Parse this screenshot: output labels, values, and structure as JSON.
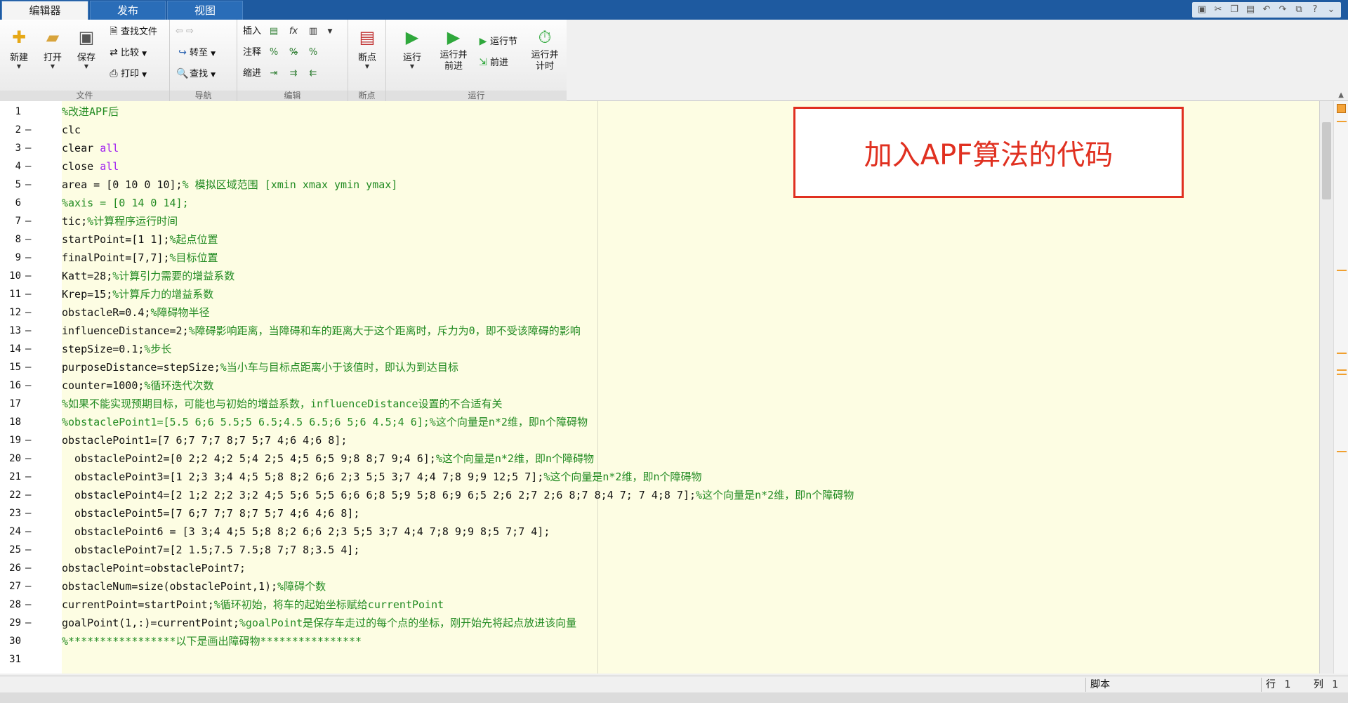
{
  "tabs": [
    {
      "label": "编辑器",
      "active": true
    },
    {
      "label": "发布",
      "active": false
    },
    {
      "label": "视图",
      "active": false
    }
  ],
  "quick_icons": [
    "save-icon",
    "cut-icon",
    "copy-icon",
    "paste-icon",
    "undo-icon",
    "redo-icon",
    "switch-window-icon",
    "help-icon",
    "collapse-icon"
  ],
  "ribbon": {
    "file": {
      "group": "文件",
      "new": "新建",
      "open": "打开",
      "save": "保存",
      "find_files": "查找文件",
      "compare": "比较",
      "print": "打印"
    },
    "nav": {
      "group": "导航",
      "goto": "转至",
      "find": "查找"
    },
    "edit": {
      "group": "编辑",
      "insert": "插入",
      "comment": "注释",
      "indent": "缩进"
    },
    "breakpoint": {
      "group": "断点",
      "breakpoints": "断点"
    },
    "run": {
      "group": "运行",
      "run": "运行",
      "run_advance_1": "运行并",
      "run_advance_2": "前进",
      "run_section": "运行节",
      "advance": "前进",
      "run_time_1": "运行并",
      "run_time_2": "计时"
    }
  },
  "annotation": "加入APF算法的代码",
  "status": {
    "mode": "脚本",
    "row_label": "行",
    "row_value": "1",
    "col_label": "列",
    "col_value": "1"
  },
  "code_lines": [
    {
      "n": "1",
      "dash": "",
      "parts": [
        [
          "cm",
          "%改进APF后"
        ]
      ]
    },
    {
      "n": "2",
      "dash": "—",
      "parts": [
        [
          "",
          "clc"
        ]
      ]
    },
    {
      "n": "3",
      "dash": "—",
      "parts": [
        [
          "",
          "clear "
        ],
        [
          "kw",
          "all"
        ]
      ]
    },
    {
      "n": "4",
      "dash": "—",
      "parts": [
        [
          "",
          "close "
        ],
        [
          "kw",
          "all"
        ]
      ]
    },
    {
      "n": "5",
      "dash": "—",
      "parts": [
        [
          "",
          "area = [0 10 0 10];"
        ],
        [
          "cm",
          "% 模拟区域范围 [xmin xmax ymin ymax]"
        ]
      ]
    },
    {
      "n": "6",
      "dash": "",
      "parts": [
        [
          "cm",
          "%axis = [0 14 0 14];"
        ]
      ]
    },
    {
      "n": "7",
      "dash": "—",
      "parts": [
        [
          "",
          "tic;"
        ],
        [
          "cm",
          "%计算程序运行时间"
        ]
      ]
    },
    {
      "n": "8",
      "dash": "—",
      "parts": [
        [
          "",
          "startPoint=[1 1];"
        ],
        [
          "cm",
          "%起点位置"
        ]
      ]
    },
    {
      "n": "9",
      "dash": "—",
      "parts": [
        [
          "",
          "finalPoint=[7,7];"
        ],
        [
          "cm",
          "%目标位置"
        ]
      ]
    },
    {
      "n": "10",
      "dash": "—",
      "parts": [
        [
          "",
          "Katt=28;"
        ],
        [
          "cm",
          "%计算引力需要的增益系数"
        ]
      ]
    },
    {
      "n": "11",
      "dash": "—",
      "parts": [
        [
          "",
          "Krep=15;"
        ],
        [
          "cm",
          "%计算斥力的增益系数"
        ]
      ]
    },
    {
      "n": "12",
      "dash": "—",
      "parts": [
        [
          "",
          "obstacleR=0.4;"
        ],
        [
          "cm",
          "%障碍物半径"
        ]
      ]
    },
    {
      "n": "13",
      "dash": "—",
      "parts": [
        [
          "",
          "influenceDistance=2;"
        ],
        [
          "cm",
          "%障碍影响距离，当障碍和车的距离大于这个距离时，斥力为0，即不受该障碍的影响"
        ]
      ]
    },
    {
      "n": "14",
      "dash": "—",
      "parts": [
        [
          "",
          "stepSize=0.1;"
        ],
        [
          "cm",
          "%步长"
        ]
      ]
    },
    {
      "n": "15",
      "dash": "—",
      "parts": [
        [
          "",
          "purposeDistance=stepSize;"
        ],
        [
          "cm",
          "%当小车与目标点距离小于该值时，即认为到达目标"
        ]
      ]
    },
    {
      "n": "16",
      "dash": "—",
      "parts": [
        [
          "",
          "counter=1000;"
        ],
        [
          "cm",
          "%循环迭代次数"
        ]
      ]
    },
    {
      "n": "17",
      "dash": "",
      "parts": [
        [
          "cm",
          "%如果不能实现预期目标，可能也与初始的增益系数，influenceDistance设置的不合适有关"
        ]
      ]
    },
    {
      "n": "18",
      "dash": "",
      "parts": [
        [
          "cm",
          "%obstaclePoint1=[5.5 6;6 5.5;5 6.5;4.5 6.5;6 5;6 4.5;4 6];%这个向量是n*2维，即n个障碍物"
        ]
      ]
    },
    {
      "n": "19",
      "dash": "—",
      "parts": [
        [
          "",
          "obstaclePoint1=[7 6;7 7;7 8;7 5;7 4;6 4;6 8];"
        ]
      ]
    },
    {
      "n": "20",
      "dash": "—",
      "parts": [
        [
          "",
          "  obstaclePoint2=[0 2;2 4;2 5;4 2;5 4;5 6;5 9;8 8;7 9;4 6];"
        ],
        [
          "cm",
          "%这个向量是n*2维，即n个障碍物"
        ]
      ]
    },
    {
      "n": "21",
      "dash": "—",
      "parts": [
        [
          "",
          "  obstaclePoint3=[1 2;3 3;4 4;5 5;8 8;2 6;6 2;3 5;5 3;7 4;4 7;8 9;9 12;5 7];"
        ],
        [
          "cm",
          "%这个向量是n*2维，即n个障碍物"
        ]
      ]
    },
    {
      "n": "22",
      "dash": "—",
      "parts": [
        [
          "",
          "  obstaclePoint4=[2 1;2 2;2 3;2 4;5 5;6 5;5 6;6 6;8 5;9 5;8 6;9 6;5 2;6 2;7 2;6 8;7 8;4 7; 7 4;8 7];"
        ],
        [
          "cm",
          "%这个向量是n*2维，即n个障碍物"
        ]
      ]
    },
    {
      "n": "23",
      "dash": "—",
      "parts": [
        [
          "",
          "  obstaclePoint5=[7 6;7 7;7 8;7 5;7 4;6 4;6 8];"
        ]
      ]
    },
    {
      "n": "24",
      "dash": "—",
      "parts": [
        [
          "",
          "  obstaclePoint6 = [3 3;4 4;5 5;8 8;2 6;6 2;3 5;5 3;7 4;4 7;8 9;9 8;5 7;7 4];"
        ]
      ]
    },
    {
      "n": "25",
      "dash": "—",
      "parts": [
        [
          "",
          "  obstaclePoint7=[2 1.5;7.5 7.5;8 7;7 8;3.5 4];"
        ]
      ]
    },
    {
      "n": "26",
      "dash": "—",
      "parts": [
        [
          "",
          "obstaclePoint=obstaclePoint7;"
        ]
      ]
    },
    {
      "n": "27",
      "dash": "—",
      "parts": [
        [
          "",
          "obstacleNum=size(obstaclePoint,1);"
        ],
        [
          "cm",
          "%障碍个数"
        ]
      ]
    },
    {
      "n": "28",
      "dash": "—",
      "parts": [
        [
          "",
          "currentPoint=startPoint;"
        ],
        [
          "cm",
          "%循环初始，将车的起始坐标赋给currentPoint"
        ]
      ]
    },
    {
      "n": "29",
      "dash": "—",
      "parts": [
        [
          "",
          "goalPoint(1,:)=currentPoint;"
        ],
        [
          "cm",
          "%goalPoint是保存车走过的每个点的坐标，刚开始先将起点放进该向量"
        ]
      ]
    },
    {
      "n": "30",
      "dash": "",
      "parts": [
        [
          "cm",
          "%*****************以下是画出障碍物****************"
        ]
      ]
    },
    {
      "n": "31",
      "dash": "",
      "parts": [
        [
          "",
          ""
        ]
      ]
    }
  ]
}
